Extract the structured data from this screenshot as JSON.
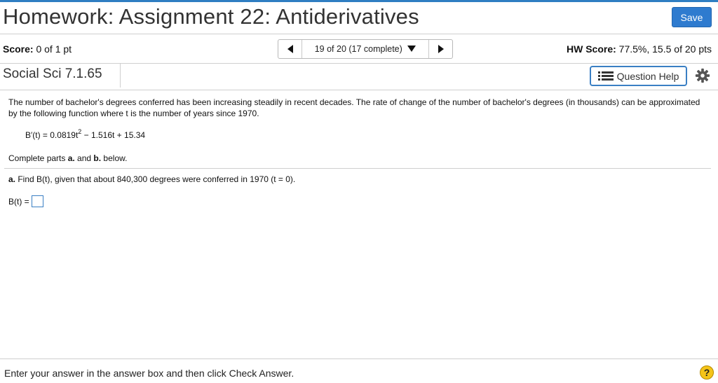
{
  "header": {
    "title": "Homework: Assignment 22: Antiderivatives",
    "save_label": "Save"
  },
  "status_bar": {
    "score_label": "Score:",
    "score_value": "0 of 1 pt",
    "nav_selected": "19 of 20 (17 complete)",
    "hw_score_label": "HW Score:",
    "hw_score_value": "77.5%, 15.5 of 20 pts"
  },
  "question_bar": {
    "question_id": "Social Sci 7.1.65",
    "help_label": "Question Help"
  },
  "question": {
    "intro": "The number of bachelor's degrees conferred has been increasing steadily in recent decades. The rate of change of the number of bachelor's degrees (in thousands) can be approximated by the following function where t is the number of years since 1970.",
    "formula_lhs": "B′(t) = 0.0819t",
    "formula_exp": "2",
    "formula_rest": " − 1.516t + 15.34",
    "parts_prefix": "Complete parts ",
    "parts_a": "a.",
    "parts_mid": " and ",
    "parts_b": "b.",
    "parts_suffix": " below.",
    "part_a_label": "a.",
    "part_a_text": " Find B(t), given that about 840,300 degrees were conferred in 1970 (t = 0).",
    "answer_label": "B(t) =",
    "answer_value": ""
  },
  "footer": {
    "instruction": "Enter your answer in the answer box and then click Check Answer.",
    "help_symbol": "?"
  },
  "icons": {
    "prev": "left-triangle-icon",
    "next": "right-triangle-icon",
    "dropdown": "chevron-down-icon",
    "help_list": "list-icon",
    "settings": "gear-icon",
    "footer_help": "question-mark-icon"
  },
  "colors": {
    "accent_blue": "#2e7bcf",
    "help_yellow": "#f5c419"
  }
}
